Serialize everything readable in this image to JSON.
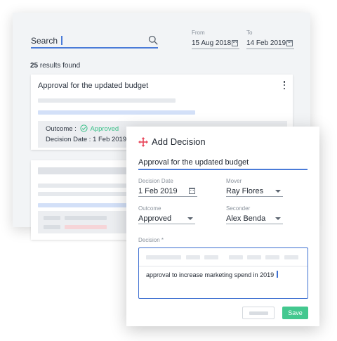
{
  "search": {
    "label": "Search",
    "icon": "search-icon"
  },
  "date_from": {
    "label": "From",
    "value": "15 Aug 2018",
    "icon": "calendar-icon"
  },
  "date_to": {
    "label": "To",
    "value": "14 Feb 2019",
    "icon": "calendar-icon"
  },
  "results": {
    "count": "25",
    "suffix": "results found"
  },
  "result_card": {
    "title": "Approval for the updated budget",
    "outcome_label": "Outcome :",
    "outcome_value": "Approved",
    "decision_date_label": "Decision Date :",
    "decision_date_value": "1 Feb 2019"
  },
  "dialog": {
    "title": "Add Decision",
    "decision_title_value": "Approval for the updated budget",
    "decision_date": {
      "label": "Decision Date",
      "value": "1 Feb 2019"
    },
    "mover": {
      "label": "Mover",
      "value": "Ray Flores"
    },
    "outcome": {
      "label": "Outcome",
      "value": "Approved"
    },
    "seconder": {
      "label": "Seconder",
      "value": "Alex Benda"
    },
    "decision_label": "Decision *",
    "decision_text": "approval to increase marketing spend in 2019",
    "save_label": "Save"
  },
  "colors": {
    "accent": "#4a7bd8",
    "success": "#43c88f",
    "approved_text": "#3cc18a",
    "move_icon": "#e8455a",
    "skeleton_blue": "#d3e0f8",
    "skeleton_grey": "#e6e9ed",
    "skeleton_red": "#f6d5d8"
  }
}
